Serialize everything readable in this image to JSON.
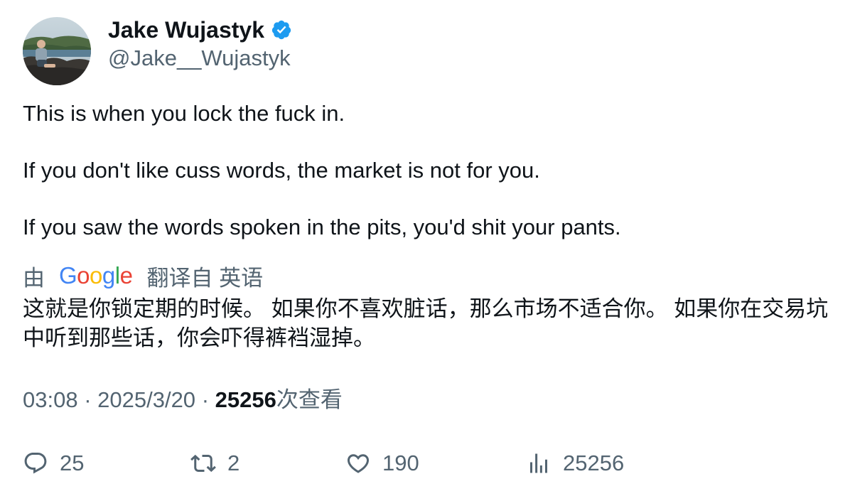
{
  "author": {
    "display_name": "Jake Wujastyk",
    "handle": "@Jake__Wujastyk",
    "verified": true,
    "verified_color": "#1d9bf0"
  },
  "tweet": {
    "paragraphs": [
      "This is when you lock the fuck in.",
      "If you don't like cuss words, the market is not for you.",
      "If you saw the words spoken in the pits, you'd shit your pants."
    ]
  },
  "translation": {
    "prefix": "由",
    "logo_text": "Google",
    "suffix": "翻译自 英语",
    "text": "这就是你锁定期的时候。 如果你不喜欢脏话，那么市场不适合你。 如果你在交易坑中听到那些话，你会吓得裤裆湿掉。"
  },
  "meta": {
    "time": "03:08",
    "separator": "·",
    "date": "2025/3/20",
    "views_count": "25256",
    "views_label": "次查看"
  },
  "actions": {
    "replies": "25",
    "retweets": "2",
    "likes": "190",
    "views": "25256"
  },
  "colors": {
    "text_primary": "#0f1419",
    "text_secondary": "#536471"
  }
}
